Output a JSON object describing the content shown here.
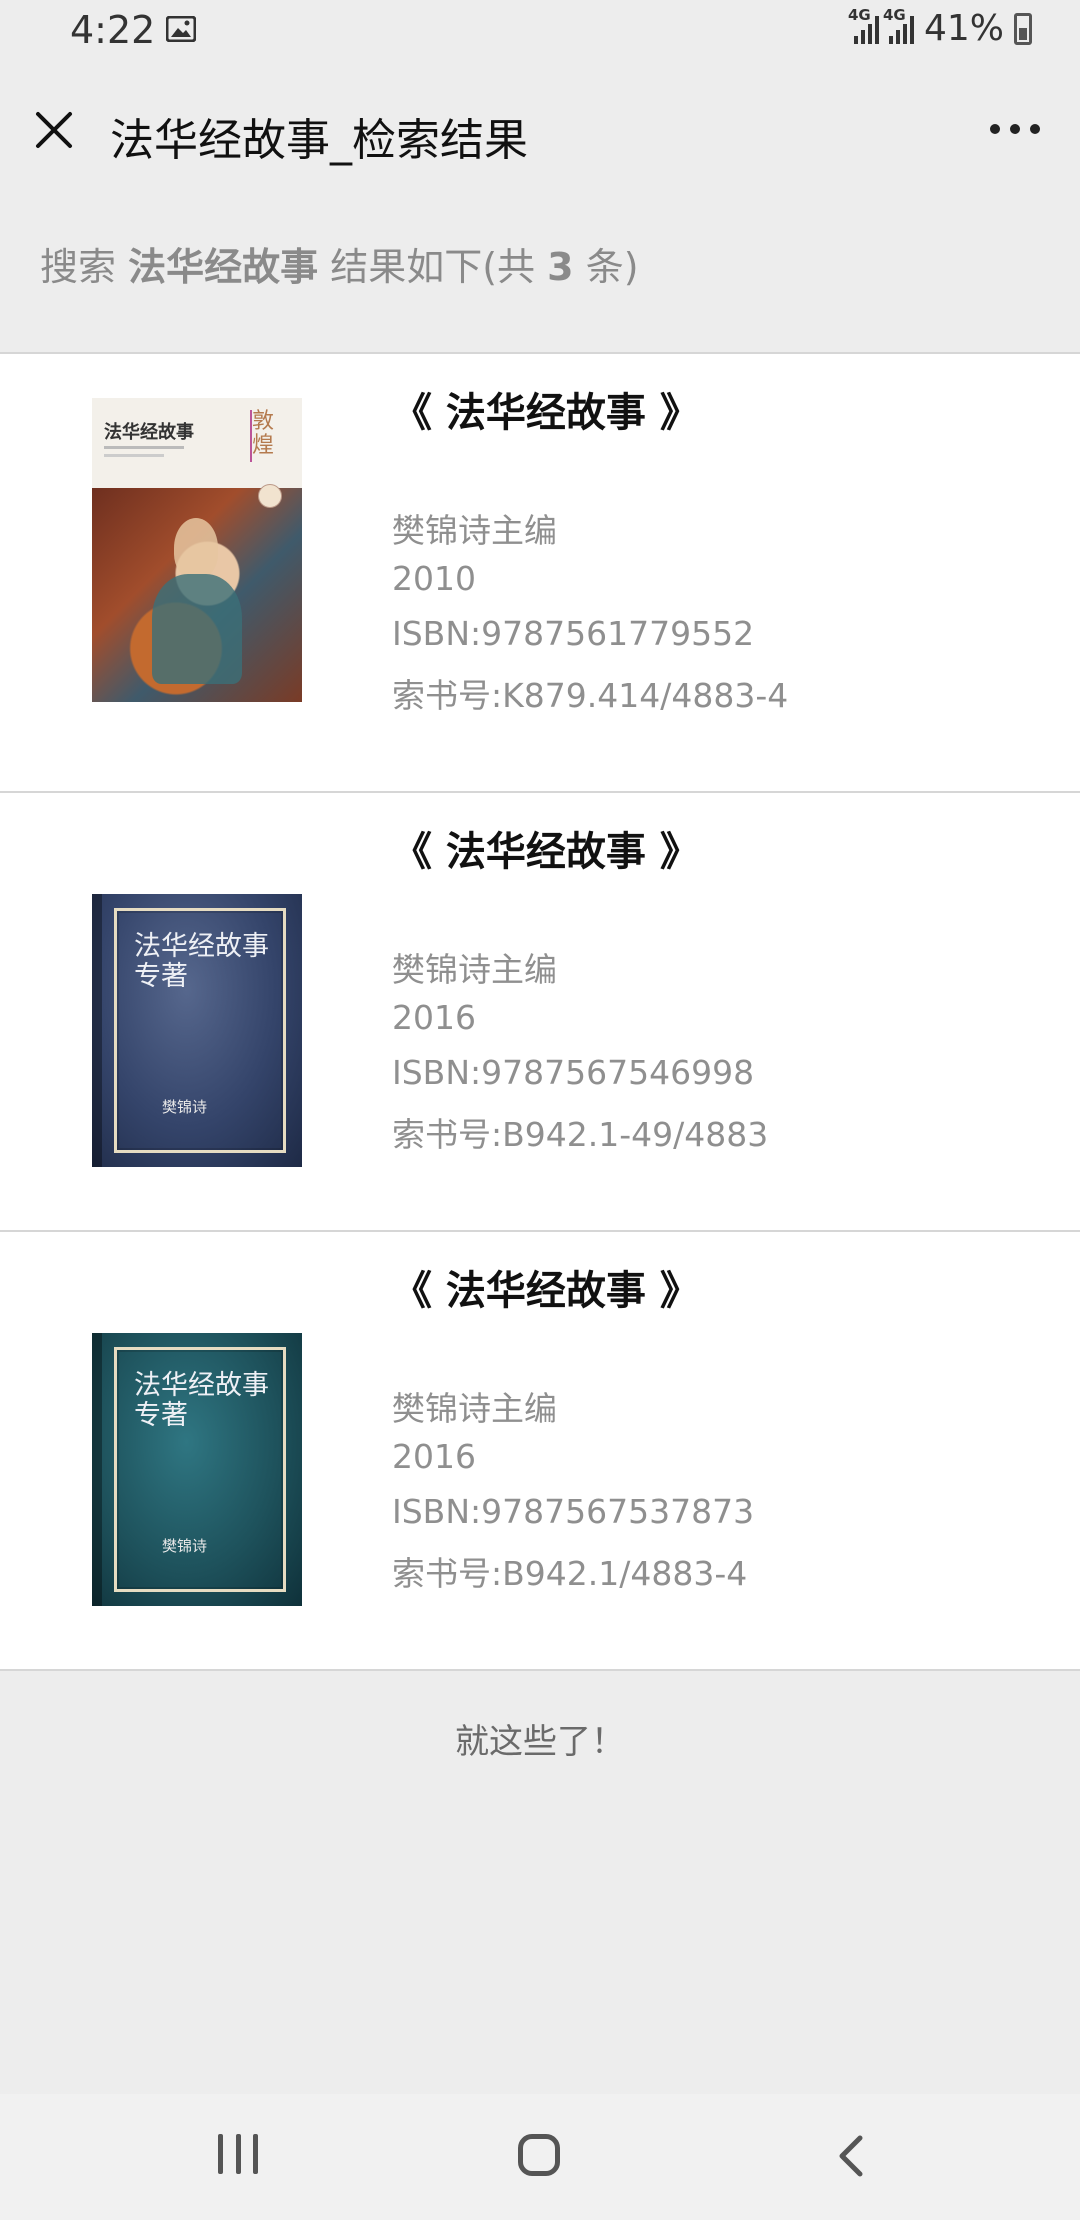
{
  "status_bar": {
    "time": "4:22",
    "network_1": "4G",
    "network_2": "4G",
    "battery": "41%"
  },
  "title_bar": {
    "title": "法华经故事_检索结果"
  },
  "summary": {
    "prefix": "搜索",
    "query": "法华经故事",
    "middle": "结果如下(共",
    "count": "3",
    "suffix": "条)"
  },
  "results": [
    {
      "title": "《 法华经故事 》",
      "author": "樊锦诗主编",
      "year": "2010",
      "isbn": "ISBN:9787561779552",
      "call_number": "索书号:K879.414/4883-4",
      "cover": {
        "style": "illustrated",
        "title_text": "法华经故事",
        "side_text": "敦煌"
      }
    },
    {
      "title": "《 法华经故事 》",
      "author": "樊锦诗主编",
      "year": "2016",
      "isbn": "ISBN:9787567546998",
      "call_number": "索书号:B942.1-49/4883",
      "cover": {
        "style": "plain-blue",
        "title_text": "法华经故事专著",
        "author_text": "樊锦诗"
      }
    },
    {
      "title": "《 法华经故事 》",
      "author": "樊锦诗主编",
      "year": "2016",
      "isbn": "ISBN:9787567537873",
      "call_number": "索书号:B942.1/4883-4",
      "cover": {
        "style": "plain-teal",
        "title_text": "法华经故事专著",
        "author_text": "樊锦诗"
      }
    }
  ],
  "footer_note": "就这些了！",
  "colors": {
    "background": "#ededed",
    "card": "#ffffff",
    "muted_text": "#8f8f8f"
  }
}
